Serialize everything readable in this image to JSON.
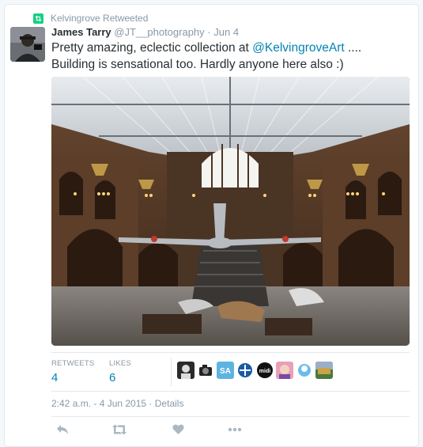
{
  "retweet_line": {
    "text": "Kelvingrove Retweeted"
  },
  "tweet": {
    "name": "James Tarry",
    "handle": "@JT__photography",
    "separator": "·",
    "date": "Jun 4",
    "text_part1": "Pretty amazing, eclectic collection at ",
    "mention": "@KelvingroveArt",
    "text_part2": " .... Building is sensational too. Hardly anyone here also :)",
    "timestamp": "2:42 a.m. - 4 Jun 2015",
    "details_link": "Details"
  },
  "stats": {
    "retweets_label": "RETWEETS",
    "retweets_value": "4",
    "likes_label": "LIKES",
    "likes_value": "6"
  },
  "likers": [
    {
      "name": "liker-1",
      "color": "#2b2b2b"
    },
    {
      "name": "liker-2",
      "color": "#ffffff"
    },
    {
      "name": "liker-3",
      "color": "#5eb4e0"
    },
    {
      "name": "liker-4",
      "color": "#ffffff"
    },
    {
      "name": "liker-5",
      "color": "#111111",
      "label": "midi"
    },
    {
      "name": "liker-6",
      "color": "#e8a0b8"
    },
    {
      "name": "liker-7",
      "color": "#6bbde8"
    },
    {
      "name": "liker-8",
      "color": "#4a7a3a"
    }
  ],
  "colors": {
    "retweet_green": "#19cf86",
    "link_blue": "#0084b4",
    "muted": "#8899a6",
    "text": "#292f33"
  }
}
